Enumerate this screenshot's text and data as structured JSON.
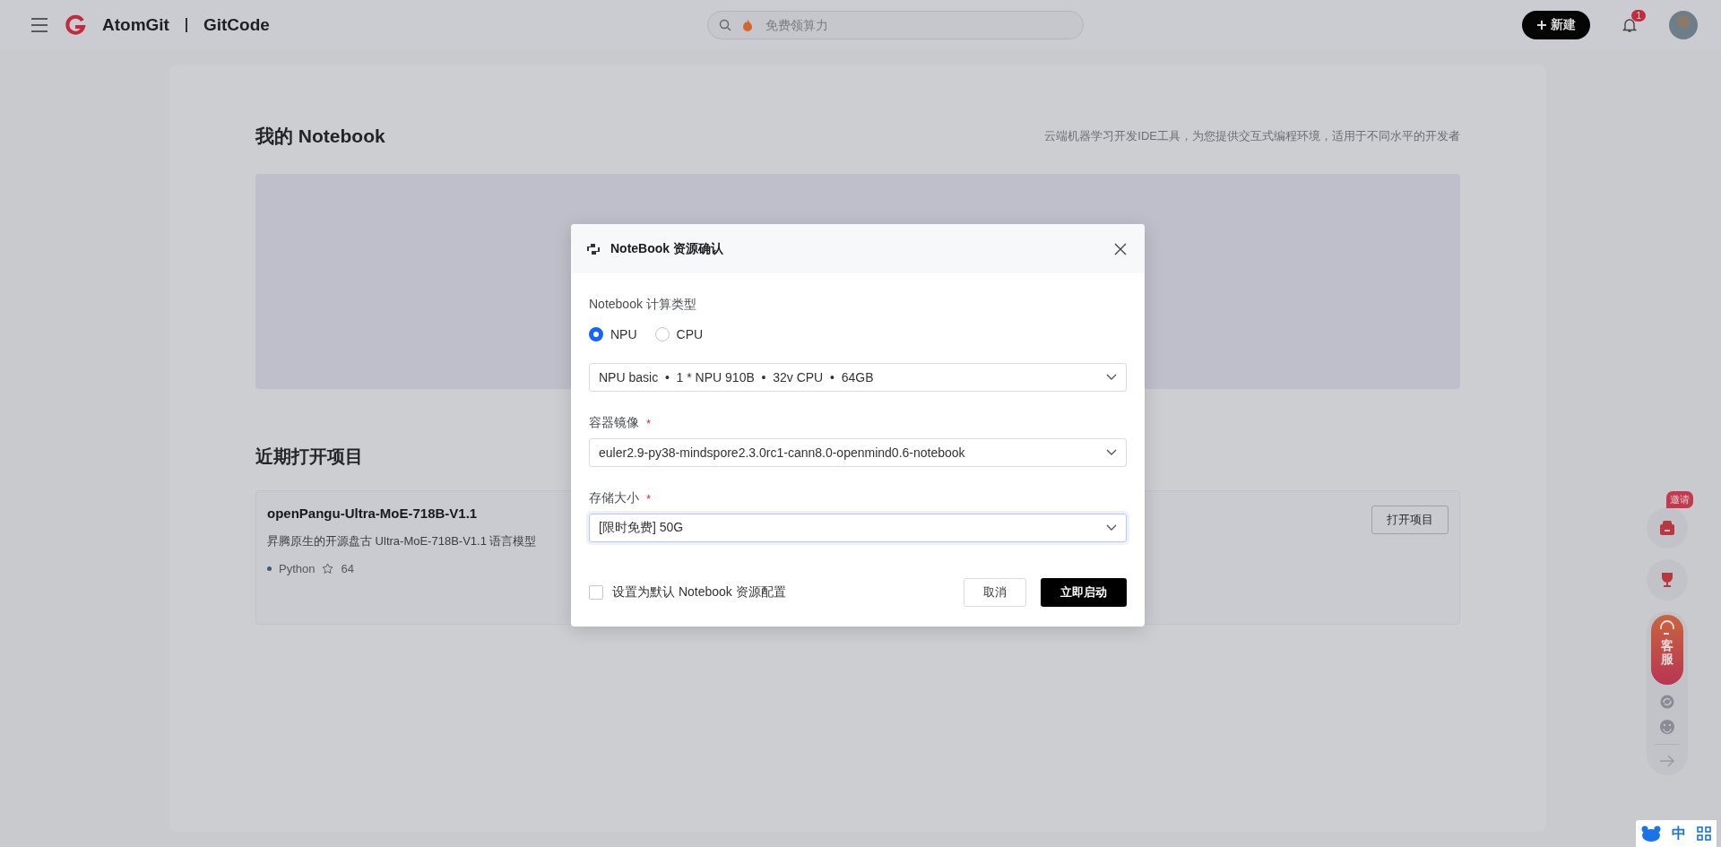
{
  "header": {
    "brand": "AtomGit",
    "brand_secondary": "GitCode",
    "search": {
      "placeholder": "免费领算力"
    },
    "new_button": "新建",
    "notification_count": "1"
  },
  "page": {
    "title": "我的 Notebook",
    "subtitle": "云端机器学习开发IDE工具，为您提供交互式编程环境，适用于不同水平的开发者",
    "recent_title": "近期打开项目",
    "projects": [
      {
        "name": "openPangu-Ultra-MoE-718B-V1.1",
        "description": "昇腾原生的开源盘古 Ultra-MoE-718B-V1.1 语言模型",
        "language": "Python",
        "stars": "64",
        "open_button": "打开项目"
      }
    ]
  },
  "dialog": {
    "title": "NoteBook 资源确认",
    "compute_type_label": "Notebook 计算类型",
    "compute_options": [
      {
        "label": "NPU",
        "selected": true
      },
      {
        "label": "CPU",
        "selected": false
      }
    ],
    "spec_value": "NPU basic  •  1 * NPU 910B  •  32v CPU  •  64GB",
    "fields": [
      {
        "label": "容器镜像",
        "required_mark": "*",
        "value": "euler2.9-py38-mindspore2.3.0rc1-cann8.0-openmind0.6-notebook",
        "focused": false
      },
      {
        "label": "存储大小",
        "required_mark": "*",
        "value": "[限时免费] 50G",
        "focused": true
      }
    ],
    "default_checkbox": {
      "label": "设置为默认 Notebook 资源配置",
      "checked": false
    },
    "cancel_button": "取消",
    "confirm_button": "立即启动"
  },
  "float_bar": {
    "invite_badge": "邀请",
    "service_label": "客服"
  },
  "ime_bar": {
    "mode": "中"
  }
}
